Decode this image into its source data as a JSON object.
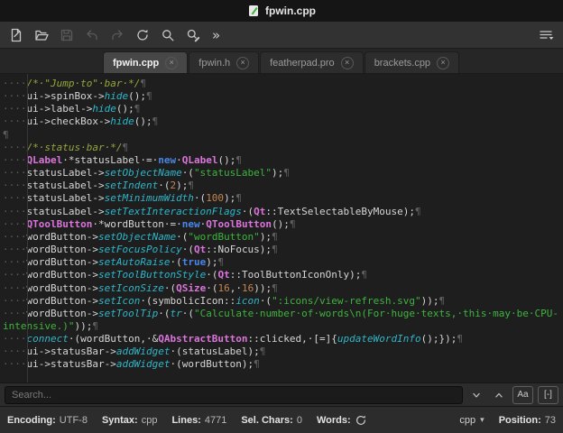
{
  "window": {
    "title": "fpwin.cpp"
  },
  "toolbar": {
    "buttons": [
      {
        "name": "new-file",
        "enabled": true
      },
      {
        "name": "open-file",
        "enabled": true
      },
      {
        "name": "save-file",
        "enabled": false
      },
      {
        "name": "undo",
        "enabled": false
      },
      {
        "name": "redo",
        "enabled": false
      },
      {
        "name": "reload",
        "enabled": true
      },
      {
        "name": "search",
        "enabled": true
      },
      {
        "name": "find-replace",
        "enabled": true
      }
    ],
    "overflow_glyph": "»"
  },
  "tabs": {
    "close_glyph": "×",
    "items": [
      {
        "label": "fpwin.cpp",
        "active": true
      },
      {
        "label": "fpwin.h",
        "active": false
      },
      {
        "label": "featherpad.pro",
        "active": false
      },
      {
        "label": "brackets.cpp",
        "active": false
      }
    ]
  },
  "editor": {
    "token_colors": {
      "default": "#d6d6d6",
      "whitespace": "#5e5e5e",
      "comment": "#95a73d",
      "string": "#3db53d",
      "keyword": "#4a86e8",
      "type": "#db74db",
      "function": "#2fb6c9",
      "number": "#c3854f"
    },
    "lines": [
      [
        {
          "c": "ws",
          "t": "····"
        },
        {
          "c": "c",
          "t": "/*·\"Jump·to\"·bar·*/"
        },
        {
          "c": "p",
          "t": "¶"
        }
      ],
      [
        {
          "c": "ws",
          "t": "····"
        },
        {
          "c": "d",
          "t": "ui->spinBox->"
        },
        {
          "c": "f",
          "t": "hide"
        },
        {
          "c": "d",
          "t": "();"
        },
        {
          "c": "p",
          "t": "¶"
        }
      ],
      [
        {
          "c": "ws",
          "t": "····"
        },
        {
          "c": "d",
          "t": "ui->label->"
        },
        {
          "c": "f",
          "t": "hide"
        },
        {
          "c": "d",
          "t": "();"
        },
        {
          "c": "p",
          "t": "¶"
        }
      ],
      [
        {
          "c": "ws",
          "t": "····"
        },
        {
          "c": "d",
          "t": "ui->checkBox->"
        },
        {
          "c": "f",
          "t": "hide"
        },
        {
          "c": "d",
          "t": "();"
        },
        {
          "c": "p",
          "t": "¶"
        }
      ],
      [
        {
          "c": "p",
          "t": "¶"
        }
      ],
      [
        {
          "c": "ws",
          "t": "····"
        },
        {
          "c": "c",
          "t": "/*·status·bar·*/"
        },
        {
          "c": "p",
          "t": "¶"
        }
      ],
      [
        {
          "c": "ws",
          "t": "····"
        },
        {
          "c": "t",
          "t": "QLabel"
        },
        {
          "c": "d",
          "t": "·*statusLabel·=·"
        },
        {
          "c": "k",
          "t": "new"
        },
        {
          "c": "d",
          "t": "·"
        },
        {
          "c": "t",
          "t": "QLabel"
        },
        {
          "c": "d",
          "t": "();"
        },
        {
          "c": "p",
          "t": "¶"
        }
      ],
      [
        {
          "c": "ws",
          "t": "····"
        },
        {
          "c": "d",
          "t": "statusLabel->"
        },
        {
          "c": "f",
          "t": "setObjectName"
        },
        {
          "c": "d",
          "t": "·("
        },
        {
          "c": "s",
          "t": "\"statusLabel\""
        },
        {
          "c": "d",
          "t": ");"
        },
        {
          "c": "p",
          "t": "¶"
        }
      ],
      [
        {
          "c": "ws",
          "t": "····"
        },
        {
          "c": "d",
          "t": "statusLabel->"
        },
        {
          "c": "f",
          "t": "setIndent"
        },
        {
          "c": "d",
          "t": "·("
        },
        {
          "c": "n",
          "t": "2"
        },
        {
          "c": "d",
          "t": ");"
        },
        {
          "c": "p",
          "t": "¶"
        }
      ],
      [
        {
          "c": "ws",
          "t": "····"
        },
        {
          "c": "d",
          "t": "statusLabel->"
        },
        {
          "c": "f",
          "t": "setMinimumWidth"
        },
        {
          "c": "d",
          "t": "·("
        },
        {
          "c": "n",
          "t": "100"
        },
        {
          "c": "d",
          "t": ");"
        },
        {
          "c": "p",
          "t": "¶"
        }
      ],
      [
        {
          "c": "ws",
          "t": "····"
        },
        {
          "c": "d",
          "t": "statusLabel->"
        },
        {
          "c": "f",
          "t": "setTextInteractionFlags"
        },
        {
          "c": "d",
          "t": "·("
        },
        {
          "c": "t",
          "t": "Qt"
        },
        {
          "c": "d",
          "t": "::TextSelectableByMouse);"
        },
        {
          "c": "p",
          "t": "¶"
        }
      ],
      [
        {
          "c": "ws",
          "t": "····"
        },
        {
          "c": "t",
          "t": "QToolButton"
        },
        {
          "c": "d",
          "t": "·*wordButton·=·"
        },
        {
          "c": "k",
          "t": "new"
        },
        {
          "c": "d",
          "t": "·"
        },
        {
          "c": "t",
          "t": "QToolButton"
        },
        {
          "c": "d",
          "t": "();"
        },
        {
          "c": "p",
          "t": "¶"
        }
      ],
      [
        {
          "c": "ws",
          "t": "····"
        },
        {
          "c": "d",
          "t": "wordButton->"
        },
        {
          "c": "f",
          "t": "setObjectName"
        },
        {
          "c": "d",
          "t": "·("
        },
        {
          "c": "s",
          "t": "\"wordButton\""
        },
        {
          "c": "d",
          "t": ");"
        },
        {
          "c": "p",
          "t": "¶"
        }
      ],
      [
        {
          "c": "ws",
          "t": "····"
        },
        {
          "c": "d",
          "t": "wordButton->"
        },
        {
          "c": "f",
          "t": "setFocusPolicy"
        },
        {
          "c": "d",
          "t": "·("
        },
        {
          "c": "t",
          "t": "Qt"
        },
        {
          "c": "d",
          "t": "::NoFocus);"
        },
        {
          "c": "p",
          "t": "¶"
        }
      ],
      [
        {
          "c": "ws",
          "t": "····"
        },
        {
          "c": "d",
          "t": "wordButton->"
        },
        {
          "c": "f",
          "t": "setAutoRaise"
        },
        {
          "c": "d",
          "t": "·("
        },
        {
          "c": "k",
          "t": "true"
        },
        {
          "c": "d",
          "t": ");"
        },
        {
          "c": "p",
          "t": "¶"
        }
      ],
      [
        {
          "c": "ws",
          "t": "····"
        },
        {
          "c": "d",
          "t": "wordButton->"
        },
        {
          "c": "f",
          "t": "setToolButtonStyle"
        },
        {
          "c": "d",
          "t": "·("
        },
        {
          "c": "t",
          "t": "Qt"
        },
        {
          "c": "d",
          "t": "::ToolButtonIconOnly);"
        },
        {
          "c": "p",
          "t": "¶"
        }
      ],
      [
        {
          "c": "ws",
          "t": "····"
        },
        {
          "c": "d",
          "t": "wordButton->"
        },
        {
          "c": "f",
          "t": "setIconSize"
        },
        {
          "c": "d",
          "t": "·("
        },
        {
          "c": "t",
          "t": "QSize"
        },
        {
          "c": "d",
          "t": "·("
        },
        {
          "c": "n",
          "t": "16"
        },
        {
          "c": "d",
          "t": ",·"
        },
        {
          "c": "n",
          "t": "16"
        },
        {
          "c": "d",
          "t": "));"
        },
        {
          "c": "p",
          "t": "¶"
        }
      ],
      [
        {
          "c": "ws",
          "t": "····"
        },
        {
          "c": "d",
          "t": "wordButton->"
        },
        {
          "c": "f",
          "t": "setIcon"
        },
        {
          "c": "d",
          "t": "·(symbolicIcon::"
        },
        {
          "c": "f",
          "t": "icon"
        },
        {
          "c": "d",
          "t": "·("
        },
        {
          "c": "s",
          "t": "\":icons/view-refresh.svg\""
        },
        {
          "c": "d",
          "t": "));"
        },
        {
          "c": "p",
          "t": "¶"
        }
      ],
      [
        {
          "c": "ws",
          "t": "····"
        },
        {
          "c": "d",
          "t": "wordButton->"
        },
        {
          "c": "f",
          "t": "setToolTip"
        },
        {
          "c": "d",
          "t": "·("
        },
        {
          "c": "f",
          "t": "tr"
        },
        {
          "c": "d",
          "t": "·("
        },
        {
          "c": "s",
          "t": "\"Calculate·number·of·words\\n(For·huge·texts,·this·may·be·CPU-"
        }
      ],
      [
        {
          "c": "s",
          "t": "intensive.)\""
        },
        {
          "c": "d",
          "t": "));"
        },
        {
          "c": "p",
          "t": "¶"
        }
      ],
      [
        {
          "c": "ws",
          "t": "····"
        },
        {
          "c": "f",
          "t": "connect"
        },
        {
          "c": "d",
          "t": "·(wordButton,·&"
        },
        {
          "c": "t",
          "t": "QAbstractButton"
        },
        {
          "c": "d",
          "t": "::clicked,·[=]{"
        },
        {
          "c": "f",
          "t": "updateWordInfo"
        },
        {
          "c": "d",
          "t": "();});"
        },
        {
          "c": "p",
          "t": "¶"
        }
      ],
      [
        {
          "c": "ws",
          "t": "····"
        },
        {
          "c": "d",
          "t": "ui->statusBar->"
        },
        {
          "c": "f",
          "t": "addWidget"
        },
        {
          "c": "d",
          "t": "·(statusLabel);"
        },
        {
          "c": "p",
          "t": "¶"
        }
      ],
      [
        {
          "c": "ws",
          "t": "····"
        },
        {
          "c": "d",
          "t": "ui->statusBar->"
        },
        {
          "c": "f",
          "t": "addWidget"
        },
        {
          "c": "d",
          "t": "·(wordButton);"
        },
        {
          "c": "p",
          "t": "¶"
        }
      ]
    ]
  },
  "search": {
    "placeholder": "Search...",
    "case_button": "Aa",
    "whole_word_button": "[-]"
  },
  "statusbar": {
    "items": [
      {
        "key": "encoding",
        "label": "Encoding:",
        "value": "UTF-8"
      },
      {
        "key": "syntax",
        "label": "Syntax:",
        "value": "cpp"
      },
      {
        "key": "lines",
        "label": "Lines:",
        "value": "4771"
      },
      {
        "key": "sel-chars",
        "label": "Sel. Chars:",
        "value": "0"
      }
    ],
    "words_label": "Words:",
    "syntax_select": "cpp",
    "caret_glyph": "▾",
    "position_label": "Position:",
    "position_value": "73"
  }
}
